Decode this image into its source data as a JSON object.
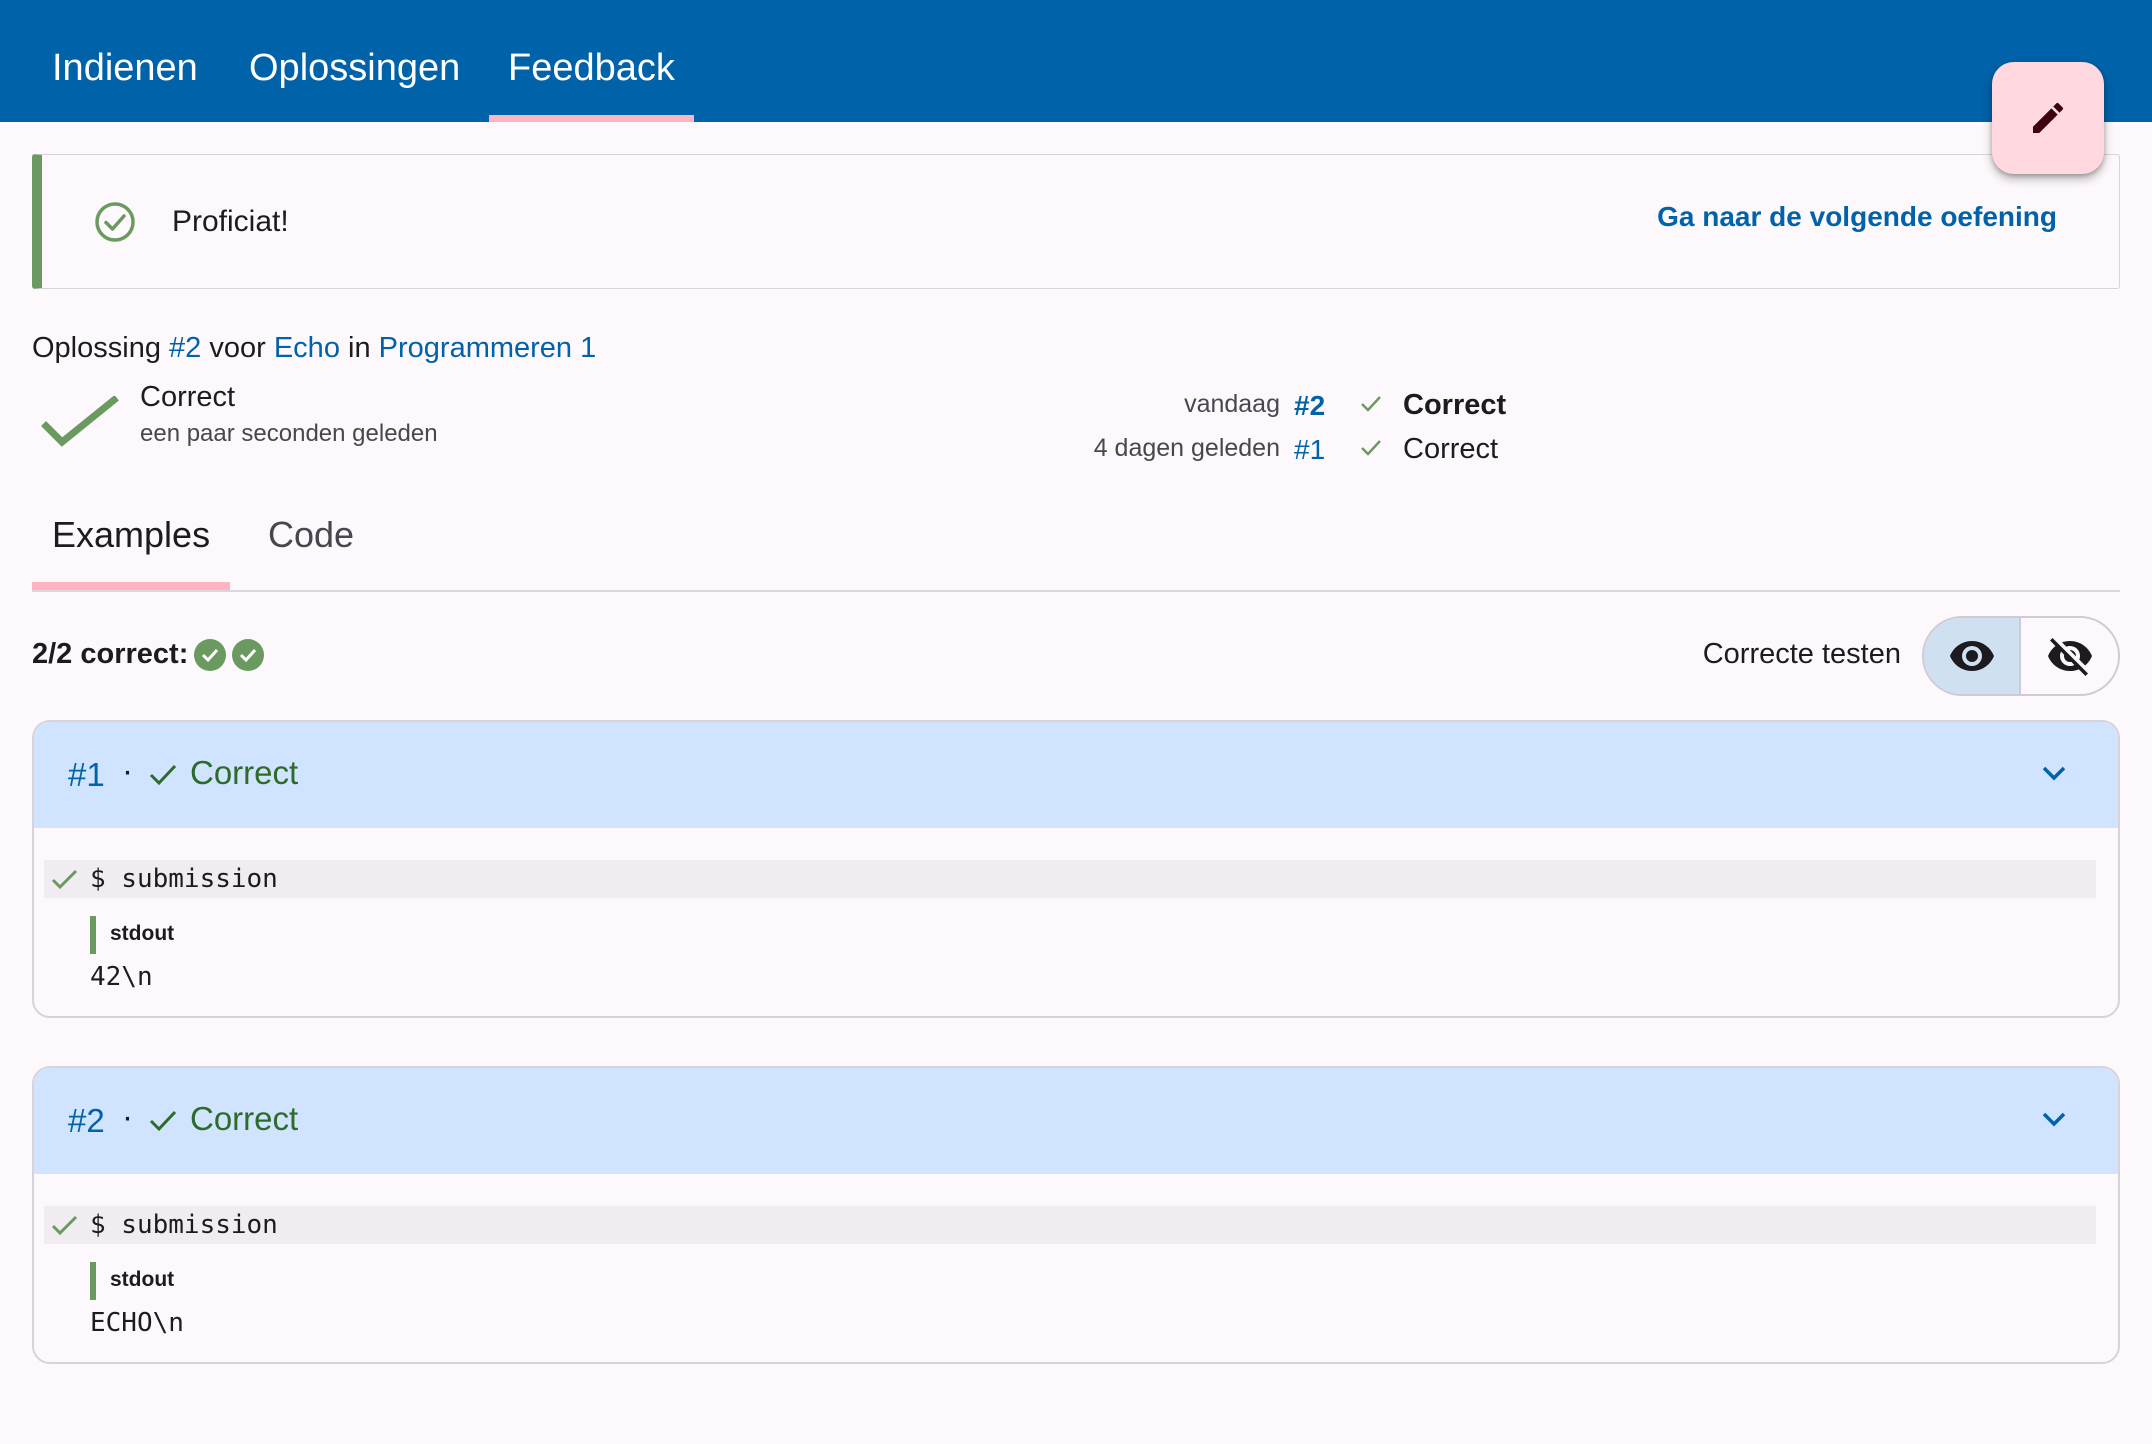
{
  "nav": {
    "tabs": [
      {
        "label": "Indienen"
      },
      {
        "label": "Oplossingen"
      },
      {
        "label": "Feedback"
      }
    ],
    "active_tab": "Feedback"
  },
  "fab": {
    "icon": "pencil-icon"
  },
  "alert": {
    "message": "Proficiat!",
    "next_link": "Ga naar de volgende oefening",
    "icon": "check-circle-icon",
    "accent_color": "#6a9a60"
  },
  "submission": {
    "prefix": "Oplossing",
    "number": "#2",
    "for_word": "voor",
    "exercise": "Echo",
    "in_word": "in",
    "course": "Programmeren 1",
    "status": "Correct",
    "time": "een paar seconden geleden"
  },
  "history": [
    {
      "when": "vandaag",
      "number": "#2",
      "status": "Correct",
      "current": true
    },
    {
      "when": "4 dagen geleden",
      "number": "#1",
      "status": "Correct",
      "current": false
    }
  ],
  "content_tabs": [
    {
      "label": "Examples"
    },
    {
      "label": "Code"
    }
  ],
  "summary": {
    "text": "2/2 correct:",
    "passed": 2,
    "total": 2
  },
  "correct_tests": {
    "label": "Correcte testen",
    "show_icon": "eye-icon",
    "hide_icon": "eye-off-icon",
    "selected": "show"
  },
  "testcases": [
    {
      "number": "#1",
      "separator": "·",
      "status": "Correct",
      "command": "$ submission",
      "channel": "stdout",
      "output": "42\\n"
    },
    {
      "number": "#2",
      "separator": "·",
      "status": "Correct",
      "command": "$ submission",
      "channel": "stdout",
      "output": "ECHO\\n"
    }
  ],
  "colors": {
    "primary": "#0062a8",
    "success": "#6a9a60",
    "tab_indicator": "#ffb4c2",
    "card_header": "#d0e4ff"
  }
}
